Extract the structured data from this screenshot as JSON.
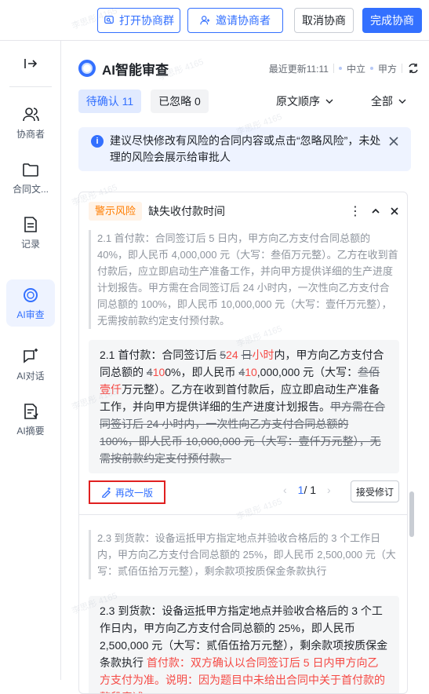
{
  "toolbar": {
    "open_group": "打开协商群",
    "invite": "邀请协商者",
    "cancel": "取消协商",
    "finish": "完成协商"
  },
  "nav": {
    "items": [
      {
        "label": "协商者",
        "icon": "users-icon"
      },
      {
        "label": "合同文...",
        "icon": "folder-icon"
      },
      {
        "label": "记录",
        "icon": "document-icon"
      },
      {
        "label": "AI审查",
        "icon": "ai-review-icon",
        "active": true
      },
      {
        "label": "AI对话",
        "icon": "chat-sparkle-icon"
      },
      {
        "label": "AI摘要",
        "icon": "summary-icon"
      }
    ]
  },
  "header": {
    "title": "AI智能审查",
    "last_update": "最近更新11:11",
    "party_neutral": "中立",
    "party_a": "甲方"
  },
  "filters": {
    "pending": "待确认 11",
    "ignored": "已忽略 0",
    "order": "原文顺序",
    "scope": "全部"
  },
  "banner": {
    "text": "建议尽快修改有风险的合同内容或点击“忽略风险”，未处理的风险会展示给审批人"
  },
  "card": {
    "tag": "警示风险",
    "title": "缺失收付款时间",
    "original_1": "2.1 首付款：合同签订后 5 日内，甲方向乙方支付合同总额的 40%，即人民币 4,000,000 元（大写：叁佰万元整）。乙方在收到首付款后，应立即启动生产准备工作，并向甲方提供详细的生产进度计划报告。甲方需在合同签订后 24 小时内，一次性向乙方支付合同总额的 100%，即人民币 10,000,000 元（大写：壹仟万元整），无需按前款约定支付预付款。",
    "revised_1": {
      "p1": "2.1 首付款：合同签订后 ",
      "d1": "5",
      "i1": "24 ",
      "d2": "日",
      "i2": "小时",
      "p2": "内，甲方向乙方支付合同总额的 ",
      "d3": "4",
      "i3": "10",
      "p3": "0%，即人民币 ",
      "d4": "4",
      "i4": "10",
      "p4": ",000,000 元（大写：",
      "d5": "叁佰",
      "i5": "壹仟",
      "p5": "万元整）。乙方在收到首付款后，应立即启动生产准备工作，并向甲方提供详细的生产进度计划报告。",
      "d6": "甲方需在合同签订后 24 小时内，一次性向乙方支付合同总额的 100%，即人民币 10,000,000 元（大写：壹仟万元整），无需按前款约定支付预付款。"
    },
    "rewrite": "再改一版",
    "page_current": "1",
    "page_total": "/ 1",
    "accept": "接受修订",
    "original_2": "2.3 到货款：设备运抵甲方指定地点并验收合格后的 3 个工作日内，甲方向乙方支付合同总额的 25%，即人民币 2,500,000 元（大写：贰佰伍拾万元整），剩余款项按质保金条款执行",
    "revised_2": "2.3 到货款：设备运抵甲方指定地点并验收合格后的 3 个工作日内，甲方向乙方支付合同总额的 25%，即人民币 2,500,000 元（大写：贰佰伍拾万元整），剩余款项按质保金条款执行",
    "revised_2_red": "首付款：双方确认以合同签订后 5 日内甲方向乙方支付为准。说明：因为题目中未给出合同中关于首付款的整段表述，"
  },
  "watermark": "李思彤 4165",
  "colors": {
    "accent": "#3370ff",
    "warning": "#ff7d00",
    "insert": "#f54a45",
    "highlight_border": "#e02020"
  }
}
